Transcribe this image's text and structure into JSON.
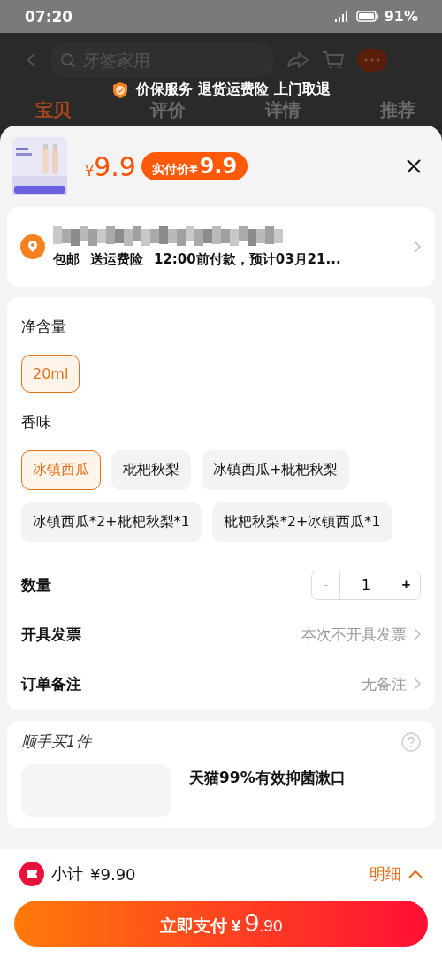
{
  "status_bar": {
    "time": "07:20",
    "battery": "91%"
  },
  "background_page": {
    "search": {
      "placeholder": "牙签家用"
    },
    "service_banner": "价保服务 退货运费险 上门取退",
    "tabs": [
      {
        "label": "宝贝",
        "selected": true
      },
      {
        "label": "评价",
        "selected": false
      },
      {
        "label": "详情",
        "selected": false
      },
      {
        "label": "推荐",
        "selected": false
      }
    ]
  },
  "sheet": {
    "price_symbol": "¥",
    "price": "9.9",
    "final_price_label": "实付价",
    "final_price_symbol": "¥",
    "final_price": "9.9",
    "delivery": {
      "tags": [
        "包邮",
        "送运费险"
      ],
      "note": "12:00前付款，预计03月21..."
    },
    "option_groups": [
      {
        "title": "净含量",
        "options": [
          {
            "label": "20ml",
            "selected": true
          }
        ]
      },
      {
        "title": "香味",
        "options": [
          {
            "label": "冰镇西瓜",
            "selected": true
          },
          {
            "label": "枇杷秋梨",
            "selected": false
          },
          {
            "label": "冰镇西瓜+枇杷秋梨",
            "selected": false
          },
          {
            "label": "冰镇西瓜*2+枇杷秋梨*1",
            "selected": false
          },
          {
            "label": "枇杷秋梨*2+冰镇西瓜*1",
            "selected": false
          }
        ]
      }
    ],
    "quantity": {
      "label": "数量",
      "minus": "-",
      "value": "1",
      "plus": "+",
      "minus_disabled": true
    },
    "settings": [
      {
        "label": "开具发票",
        "value": "本次不开具发票"
      },
      {
        "label": "订单备注",
        "value": "无备注"
      }
    ],
    "addon": {
      "title": "顺手买1件",
      "product_title": "天猫99%有效抑菌漱口"
    }
  },
  "footer": {
    "subtotal_label": "小计",
    "subtotal": "¥9.90",
    "details": "明细",
    "pay_label": "立即支付",
    "pay_symbol": "¥",
    "pay_int": "9",
    "pay_dec": ".90"
  }
}
